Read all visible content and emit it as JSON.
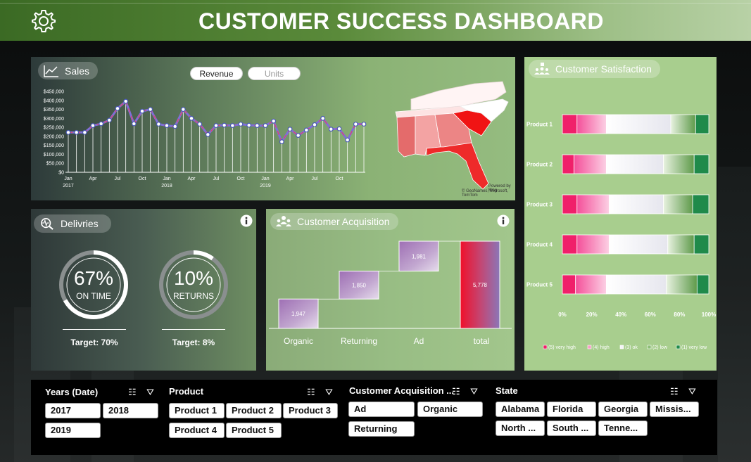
{
  "header": {
    "title": "CUSTOMER SUCCESS DASHBOARD"
  },
  "sales": {
    "label": "Sales",
    "toggle_revenue": "Revenue",
    "toggle_units": "Units",
    "map_credit_1": "Powered by Bing",
    "map_credit_2": "© GeoNames, Microsoft, TomTom",
    "map_colors": {
      "light": "#fbe9e9",
      "mid": "#f3a3a3",
      "strong": "#e46b6b",
      "max": "#f01414"
    }
  },
  "chart_data": {
    "type": "line",
    "title": "",
    "ylim": [
      0,
      450000
    ],
    "yticks": [
      "$0",
      "$50,000",
      "$100,000",
      "$150,000",
      "$200,000",
      "$250,000",
      "$300,000",
      "$350,000",
      "$400,000",
      "$450,000"
    ],
    "xtick_labels": [
      {
        "month": "Jan",
        "year": "2017",
        "i": 0
      },
      {
        "month": "Apr",
        "year": "",
        "i": 3
      },
      {
        "month": "Jul",
        "year": "",
        "i": 6
      },
      {
        "month": "Oct",
        "year": "",
        "i": 9
      },
      {
        "month": "Jan",
        "year": "2018",
        "i": 12
      },
      {
        "month": "Apr",
        "year": "",
        "i": 15
      },
      {
        "month": "Jul",
        "year": "",
        "i": 18
      },
      {
        "month": "Oct",
        "year": "",
        "i": 21
      },
      {
        "month": "Jan",
        "year": "2019",
        "i": 24
      },
      {
        "month": "Apr",
        "year": "",
        "i": 27
      },
      {
        "month": "Jul",
        "year": "",
        "i": 30
      },
      {
        "month": "Oct",
        "year": "",
        "i": 33
      }
    ],
    "values": [
      222000,
      222000,
      222000,
      260000,
      270000,
      290000,
      355000,
      395000,
      270000,
      340000,
      350000,
      268000,
      260000,
      255000,
      350000,
      300000,
      268000,
      210000,
      260000,
      262000,
      260000,
      268000,
      262000,
      260000,
      260000,
      285000,
      170000,
      240000,
      205000,
      235000,
      265000,
      300000,
      240000,
      242000,
      180000,
      268000,
      268000
    ]
  },
  "deliveries": {
    "label": "Delivries",
    "gauges": [
      {
        "value": "67%",
        "sublabel": "ON TIME",
        "fraction": 0.67,
        "target": "Target: 70%"
      },
      {
        "value": "10%",
        "sublabel": "RETURNS",
        "fraction": 0.1,
        "target": "Target: 8%"
      }
    ]
  },
  "acquisition": {
    "label": "Customer Acquisition",
    "waterfall": [
      {
        "category": "Organic",
        "value": 1947,
        "label": "1,947"
      },
      {
        "category": "Returning",
        "value": 1850,
        "label": "1,850"
      },
      {
        "category": "Ad",
        "value": 1981,
        "label": "1,981"
      },
      {
        "category": "total",
        "value": 5778,
        "label": "5,778"
      }
    ]
  },
  "satisfaction": {
    "label": "Customer Satisfaction",
    "products": [
      {
        "name": "Product 1",
        "shares": [
          0.1,
          0.2,
          0.44,
          0.17,
          0.09
        ]
      },
      {
        "name": "Product 2",
        "shares": [
          0.08,
          0.22,
          0.39,
          0.21,
          0.1
        ]
      },
      {
        "name": "Product 3",
        "shares": [
          0.1,
          0.22,
          0.37,
          0.2,
          0.11
        ]
      },
      {
        "name": "Product 4",
        "shares": [
          0.1,
          0.22,
          0.4,
          0.18,
          0.1
        ]
      },
      {
        "name": "Product 5",
        "shares": [
          0.09,
          0.21,
          0.41,
          0.21,
          0.08
        ]
      }
    ],
    "xticks": [
      "0%",
      "20%",
      "40%",
      "60%",
      "80%",
      "100%"
    ],
    "legend": [
      "(5) very high",
      "(4) high",
      "(3) ok",
      "(2) low",
      "(1) very low"
    ],
    "colors": [
      "#f0206a",
      "#f99cc6",
      "#f4f4f8",
      "#8cbd76",
      "#1f8a4a"
    ]
  },
  "slicers": {
    "years": {
      "title": "Years (Date)",
      "items": [
        "2017",
        "2018",
        "2019"
      ]
    },
    "product": {
      "title": "Product",
      "items": [
        "Product 1",
        "Product 2",
        "Product 3",
        "Product 4",
        "Product 5"
      ]
    },
    "acquisition": {
      "title": "Customer Acquisition ...",
      "items": [
        "Ad",
        "Organic",
        "Returning"
      ]
    },
    "state": {
      "title": "State",
      "items": [
        "Alabama",
        "Florida",
        "Georgia",
        "Missis...",
        "North ...",
        "South ...",
        "Tenne..."
      ]
    }
  }
}
